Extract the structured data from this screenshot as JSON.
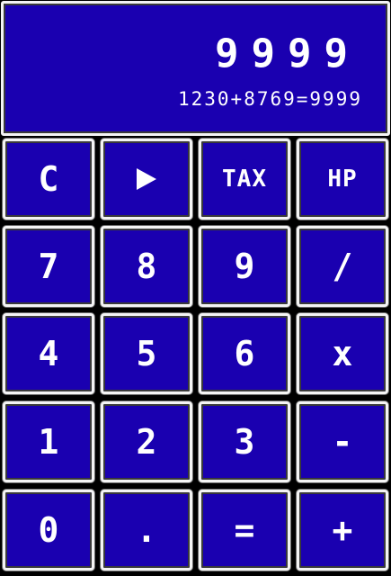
{
  "display": {
    "main_value": "9999",
    "expression": "1230+8769=9999"
  },
  "keys": {
    "clear": "C",
    "play_icon": "play-icon",
    "tax": "TAX",
    "hp": "HP",
    "seven": "7",
    "eight": "8",
    "nine": "9",
    "divide": "/",
    "four": "4",
    "five": "5",
    "six": "6",
    "multiply": "x",
    "one": "1",
    "two": "2",
    "three": "3",
    "minus": "-",
    "zero": "0",
    "dot": ".",
    "equals": "=",
    "plus": "+"
  },
  "colors": {
    "background": "#1a00b0",
    "text": "#ffffff",
    "border": "#f4f4f4",
    "page": "#000000"
  }
}
